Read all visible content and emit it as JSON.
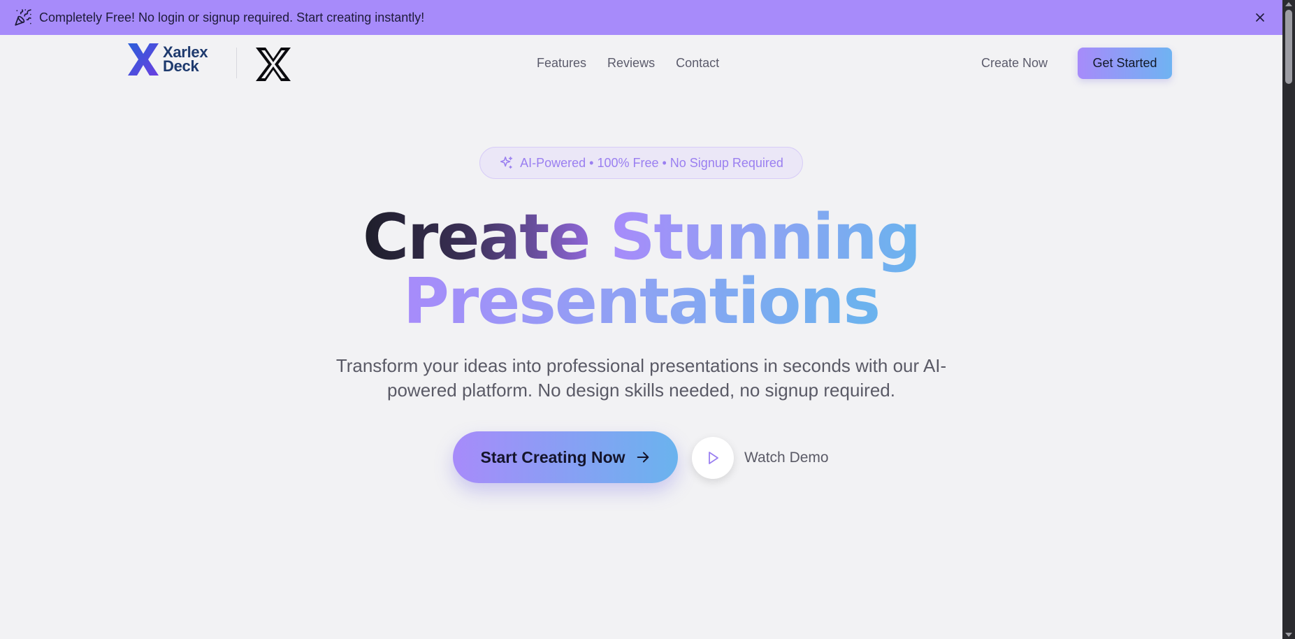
{
  "banner": {
    "icon": "party-popper-icon",
    "text": "Completely Free! No login or signup required. Start creating instantly!",
    "close_icon": "close-icon",
    "background": "#a78bfa"
  },
  "nav": {
    "logo_line1": "Xarlex",
    "logo_line2": "Deck",
    "partner_logo": "x-logo",
    "links": [
      "Features",
      "Reviews",
      "Contact"
    ],
    "create_now": "Create Now",
    "get_started": "Get Started"
  },
  "hero": {
    "badge": "AI-Powered • 100% Free • No Signup Required",
    "badge_icon": "sparkles-icon",
    "headline_part1": "Create",
    "headline_part2": "Stunning",
    "headline_line2": "Presentations",
    "subtitle": "Transform your ideas into professional presentations in seconds with our AI-powered platform. No design skills needed, no signup required.",
    "cta_label": "Start Creating Now",
    "cta_icon": "arrow-right-icon",
    "demo_icon": "play-icon",
    "demo_label": "Watch Demo"
  },
  "colors": {
    "accent_purple": "#a78bfa",
    "accent_blue": "#6ab3ee",
    "background": "#f2f2f4"
  }
}
